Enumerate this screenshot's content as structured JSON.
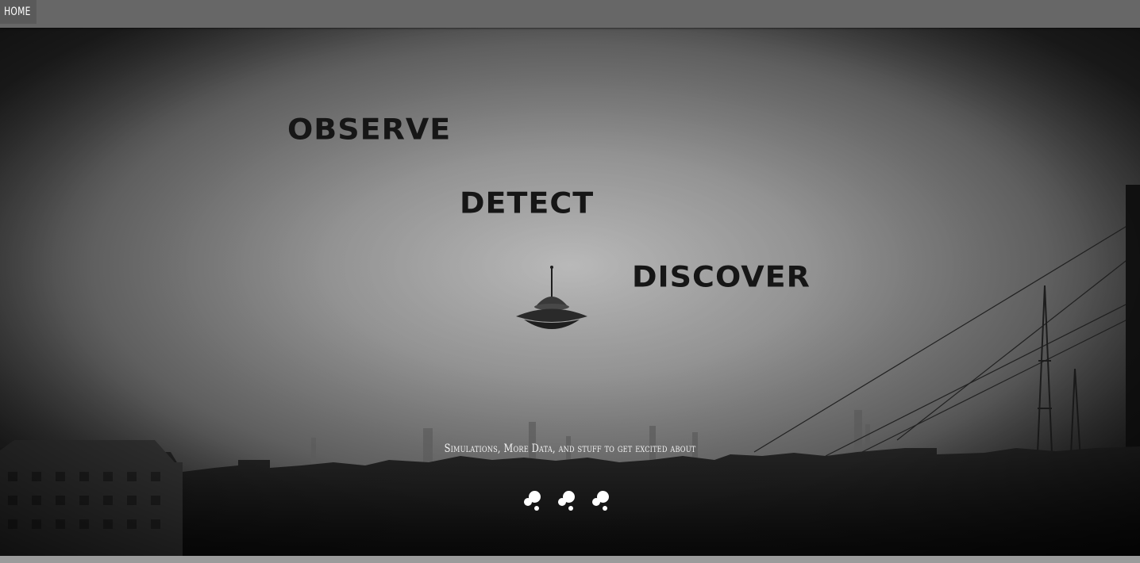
{
  "nav": {
    "home_label": "HOME"
  },
  "hero": {
    "words": [
      "OBSERVE",
      "DETECT",
      "DISCOVER"
    ],
    "subtitle": "Simulations, More Data, and stuff to get excited about",
    "scene_icon": "ufo-icon",
    "nav_dots": [
      {
        "icon": "dots-cluster-icon"
      },
      {
        "icon": "dots-cluster-icon"
      },
      {
        "icon": "dots-cluster-icon"
      }
    ]
  },
  "colors": {
    "topbar": "#676767",
    "home_bg": "#5a5a5a",
    "word_text": "#161616",
    "subtitle_text": "#f2f2f2",
    "dot": "#ffffff"
  }
}
